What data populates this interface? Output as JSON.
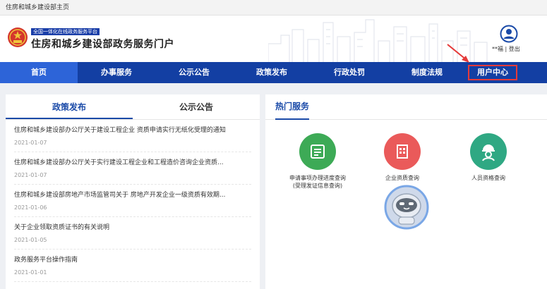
{
  "topbar": {
    "text": "住房和城乡建设部主页"
  },
  "header": {
    "slogan": "全国一体化在线政务服务平台",
    "title": "住房和城乡建设部政务服务门户",
    "user_name": "**福",
    "separator": "|",
    "logout": "登出"
  },
  "nav": {
    "items": [
      "首页",
      "办事服务",
      "公示公告",
      "政策发布",
      "行政处罚",
      "制度法规",
      "用户中心"
    ]
  },
  "left_panel": {
    "tabs": [
      "政策发布",
      "公示公告"
    ],
    "items": [
      {
        "title": "住房和城乡建设部办公厅关于建设工程企业 资质申请实行无纸化受理的通知",
        "date": "2021-01-07"
      },
      {
        "title": "住房和城乡建设部办公厅关于实行建设工程企业和工程造价咨询企业资质...",
        "date": "2021-01-07"
      },
      {
        "title": "住房和城乡建设部房地产市场监管司关于 房地产开发企业一级资质有效期...",
        "date": "2021-01-06"
      },
      {
        "title": "关于企业领取资质证书的有关说明",
        "date": "2021-01-05"
      },
      {
        "title": "政务服务平台操作指南",
        "date": "2021-01-01"
      }
    ]
  },
  "right_panel": {
    "title": "热门服务",
    "services": [
      {
        "label_line1": "申请事项办理进度查询",
        "label_line2": "(受理发证信息查询)",
        "color": "#3daa56",
        "icon": "list-icon"
      },
      {
        "label_line1": "企业资质查询",
        "label_line2": "",
        "color": "#ea5a5a",
        "icon": "building-icon"
      },
      {
        "label_line1": "人员资格查询",
        "label_line2": "",
        "color": "#2fa883",
        "icon": "worker-icon"
      }
    ]
  },
  "colors": {
    "nav_bg": "#133fa3",
    "nav_active": "#2d64d8",
    "accent": "#1a4aa8",
    "highlight_box": "#e53a3a"
  }
}
